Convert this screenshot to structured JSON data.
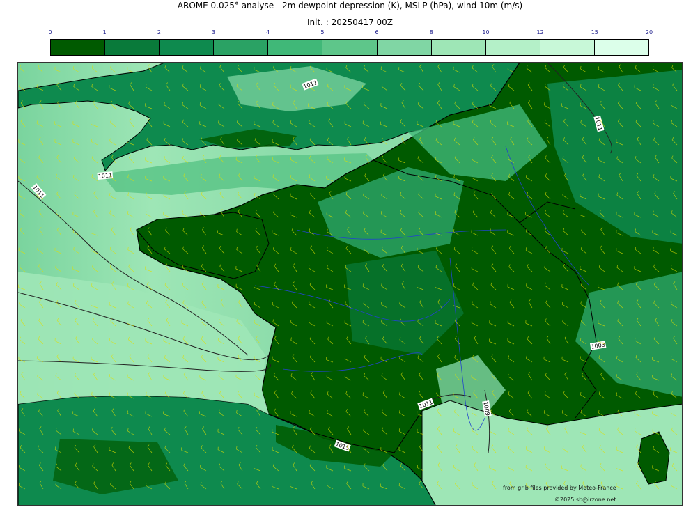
{
  "title_line1": "AROME 0.025° analyse - 2m dewpoint depression (K), MSLP (hPa), wind 10m (m/s)",
  "title_line2": "Init. : 20250417 00Z",
  "colorbar": {
    "ticks": [
      "0",
      "1",
      "2",
      "3",
      "4",
      "5",
      "6",
      "8",
      "10",
      "12",
      "15",
      "20"
    ],
    "colors": [
      "#005a00",
      "#097a3a",
      "#0e8a4e",
      "#2aa264",
      "#40b878",
      "#5ec68a",
      "#80d6a4",
      "#9ee6b6",
      "#b4f0c8",
      "#c8f8d8",
      "#dcffea"
    ]
  },
  "map": {
    "isobar_labels": [
      "1011",
      "1011",
      "1011",
      "1011",
      "1011",
      "1003",
      "1011",
      "1009",
      "1015"
    ],
    "colors": {
      "sea_light": "#9ee6b6",
      "land_dark": "#005a00",
      "coast": "#000000",
      "rivers": "#2244cc",
      "wind_barbs": "#e0e000"
    }
  },
  "credits": {
    "source": "from grib files provided by Meteo-France",
    "copyright": "©2025 sb@irzone.net"
  }
}
